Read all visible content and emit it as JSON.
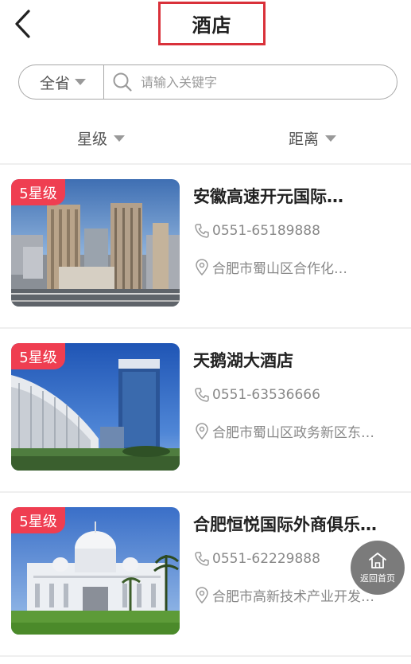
{
  "header": {
    "title": "酒店",
    "back_icon": "chevron-left-icon"
  },
  "search": {
    "province": "全省",
    "placeholder": "请输入关键字"
  },
  "filters": [
    {
      "label": "星级"
    },
    {
      "label": "距离"
    }
  ],
  "hotels": [
    {
      "badge": "5星级",
      "name": "安徽高速开元国际…",
      "phone": "0551-65189888",
      "address": "合肥市蜀山区合作化…"
    },
    {
      "badge": "5星级",
      "name": "天鹅湖大酒店",
      "phone": "0551-63536666",
      "address": "合肥市蜀山区政务新区东…"
    },
    {
      "badge": "5星级",
      "name": "合肥恒悦国际外商俱乐…",
      "phone": "0551-62229888",
      "address": "合肥市高新技术产业开发…"
    }
  ],
  "float_button": {
    "label": "返回首页",
    "icon": "home-icon"
  },
  "colors": {
    "accent": "#d9313a",
    "badge": "#ef3e51"
  }
}
